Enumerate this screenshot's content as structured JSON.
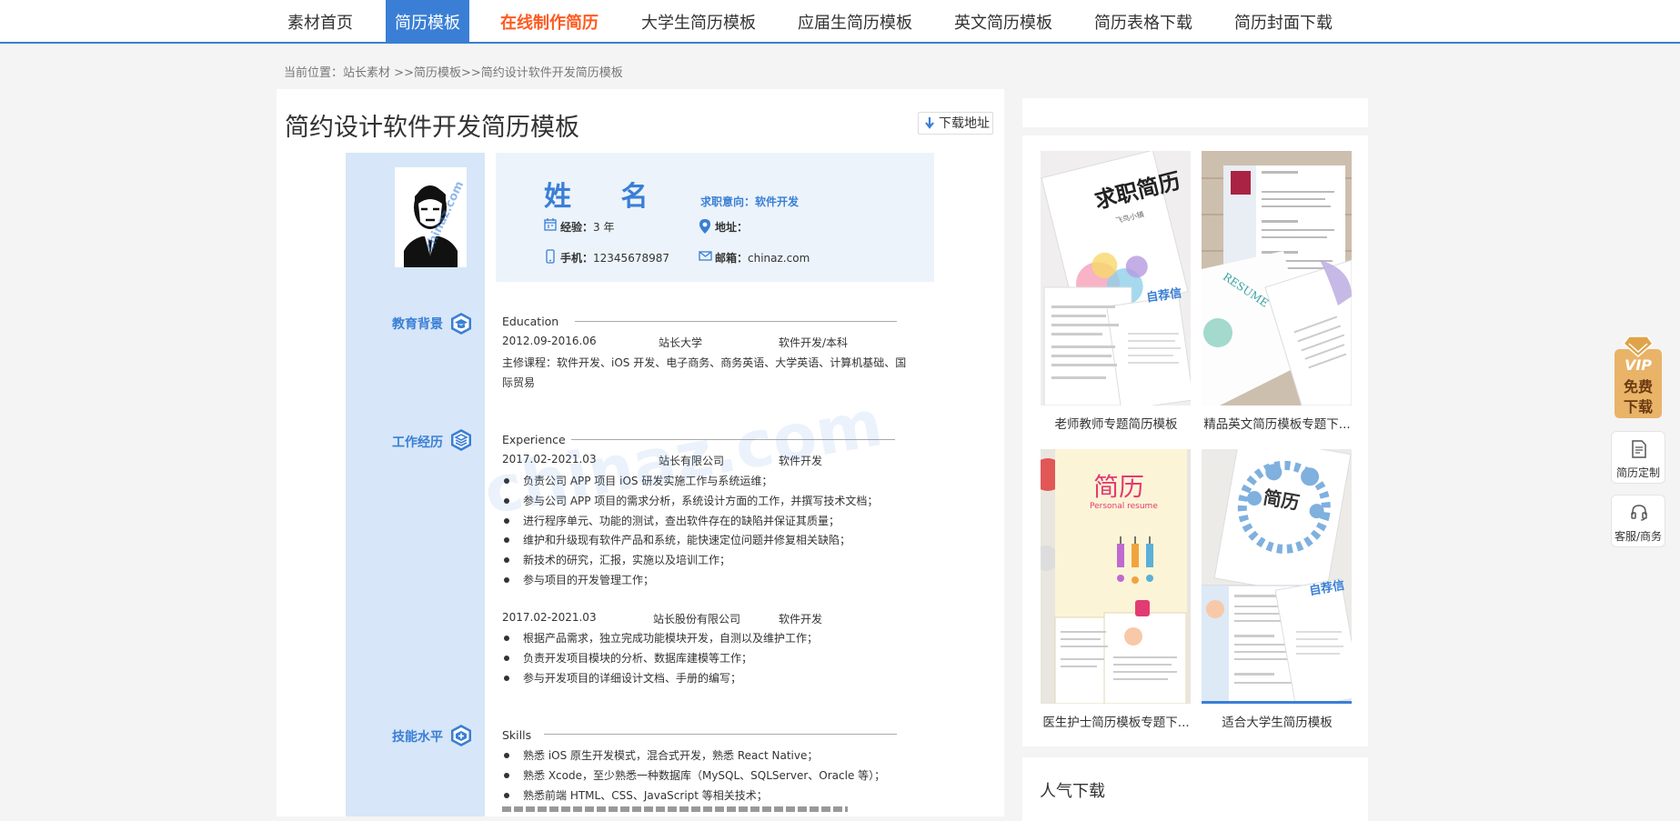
{
  "nav": {
    "items": [
      "素材首页",
      "简历模板",
      "在线制作简历",
      "大学生简历模板",
      "应届生简历模板",
      "英文简历模板",
      "简历表格下载",
      "简历封面下载"
    ]
  },
  "breadcrumb": {
    "prefix": "当前位置：",
    "items": [
      "站长素材",
      ">>",
      "简历模板",
      ">>",
      "简约设计软件开发简历模板"
    ]
  },
  "page": {
    "title": "简约设计软件开发简历模板",
    "download_label": "下载地址"
  },
  "resume": {
    "name": "姓  名",
    "intent": "求职意向：软件开发",
    "exp_label": "经验：",
    "exp_value": "3 年",
    "addr_label": "地址：",
    "addr_value": "",
    "phone_label": "手机：",
    "phone_value": "12345678987",
    "email_label": "邮箱：",
    "email_value": "chinaz.com",
    "photo_watermark": "chinaz.com",
    "watermark": "chinaz.com",
    "education": {
      "label": "教育背景",
      "en": "Education",
      "period": "2012.09-2016.06",
      "school": "站长大学",
      "major": "软件开发/本科",
      "courses_1": "主修课程：软件开发、iOS 开发、电子商务、商务英语、大学英语、计算机基础、国",
      "courses_2": "际贸易"
    },
    "work": {
      "label": "工作经历",
      "en": "Experience",
      "job1": {
        "period": "2017.02-2021.03",
        "company": "站长有限公司",
        "position": "软件开发",
        "bullets": [
          "负责公司 APP 项目 iOS 研发实施工作与系统运维；",
          "参与公司 APP 项目的需求分析，系统设计方面的工作，并撰写技术文档；",
          "进行程序单元、功能的测试，查出软件存在的缺陷并保证其质量；",
          "维护和升级现有软件产品和系统，能快速定位问题并修复相关缺陷；",
          "新技术的研究，汇报，实施以及培训工作；",
          "参与项目的开发管理工作；"
        ]
      },
      "job2": {
        "period": "2017.02-2021.03",
        "company": "站长股份有限公司",
        "position": "软件开发",
        "bullets": [
          "根据产品需求，独立完成功能模块开发，自测以及维护工作；",
          "负责开发项目模块的分析、数据库建模等工作；",
          "参与开发项目的详细设计文档、手册的编写；"
        ]
      }
    },
    "skills": {
      "label": "技能水平",
      "en": "Skills",
      "bullets": [
        "熟悉 iOS 原生开发模式，混合式开发，熟悉 React Native；",
        "熟悉 Xcode，至少熟悉一种数据库（MySQL、SQLServer、Oracle 等）；",
        "熟悉前端 HTML、CSS、JavaScript 等相关技术；"
      ]
    }
  },
  "sidebar": {
    "thumbs": [
      {
        "caption": "老师教师专题简历模板",
        "art_title": "求职简历",
        "art_sub": "飞鸟小镇",
        "art_tag": "自荐信"
      },
      {
        "caption": "精品英文简历模板专题下...",
        "art_title": "RESUME"
      },
      {
        "caption": "医生护士简历模板专题下...",
        "art_title": "简历",
        "art_sub": "Personal resume"
      },
      {
        "caption": "适合大学生简历模板",
        "art_title": "简历",
        "art_tag": "自荐信"
      }
    ],
    "popular_title": "人气下载"
  },
  "floating": {
    "vip_line1": "VIP",
    "vip_line2": "免费",
    "vip_line3": "下载",
    "custom_label": "简历定制",
    "service_label": "客服/商务"
  },
  "colors": {
    "accent": "#3a7fd5",
    "hot": "#ff5a1f",
    "resume_side": "#d7e6f8",
    "resume_head": "#ecf3fb",
    "vip_gold": "#e0a34a"
  }
}
